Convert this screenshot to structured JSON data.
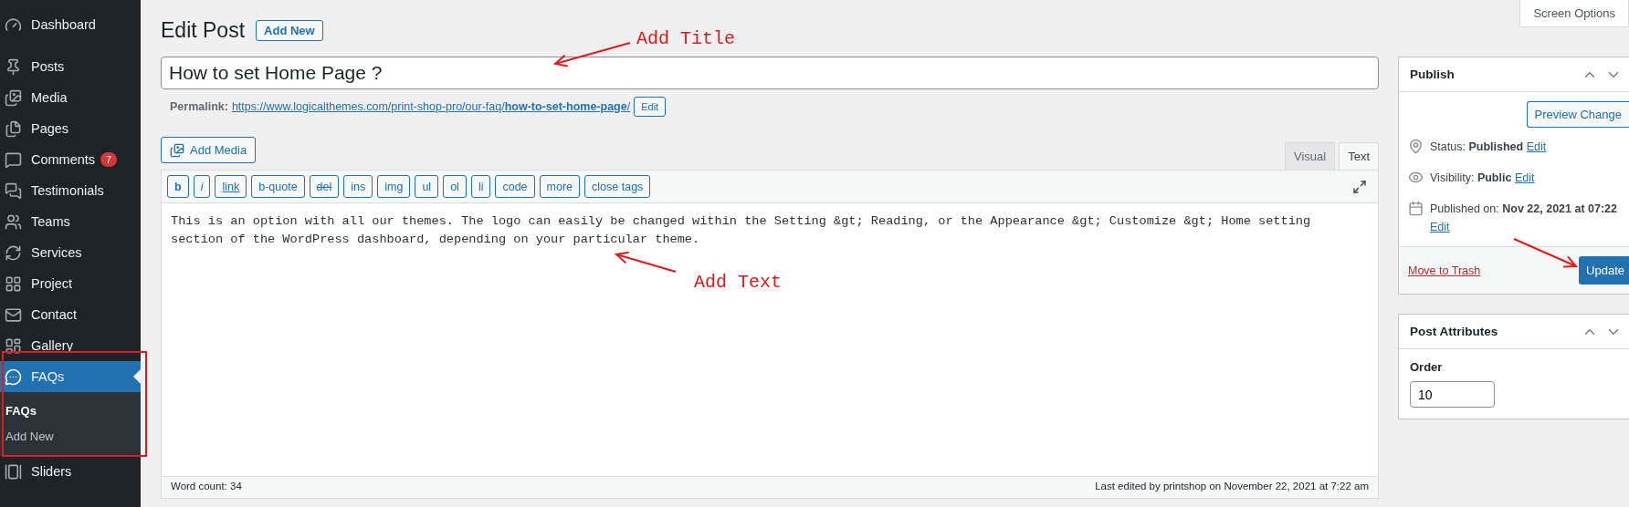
{
  "sidebar": {
    "items": [
      {
        "label": "Dashboard",
        "selected": false
      },
      {
        "label": "Posts",
        "selected": false
      },
      {
        "label": "Media",
        "selected": false
      },
      {
        "label": "Pages",
        "selected": false
      },
      {
        "label": "Comments",
        "selected": false,
        "badge": "7"
      },
      {
        "label": "Testimonials",
        "selected": false
      },
      {
        "label": "Teams",
        "selected": false
      },
      {
        "label": "Services",
        "selected": false
      },
      {
        "label": "Project",
        "selected": false
      },
      {
        "label": "Contact",
        "selected": false
      },
      {
        "label": "Gallery",
        "selected": false
      },
      {
        "label": "FAQs",
        "selected": true,
        "children": [
          {
            "label": "FAQs",
            "selected": true
          },
          {
            "label": "Add New",
            "selected": false
          }
        ]
      },
      {
        "label": "Sliders",
        "selected": false
      }
    ]
  },
  "header": {
    "title": "Edit Post",
    "add_new": "Add New"
  },
  "screen_options": "Screen Options",
  "title_field": {
    "value": "How to set Home Page ?"
  },
  "permalink": {
    "label": "Permalink:",
    "url": "https://www.logicalthemes.com/print-shop-pro/our-faq/**how-to-set-home-page**/",
    "edit": "Edit"
  },
  "add_media": "Add Media",
  "editor_tabs": [
    {
      "label": "Visual",
      "selected": false
    },
    {
      "label": "Text",
      "selected": true
    }
  ],
  "quicktags": [
    {
      "label": "b",
      "kind": "bold"
    },
    {
      "label": "i",
      "kind": "italic"
    },
    {
      "label": "link",
      "kind": "underline"
    },
    {
      "label": "b-quote",
      "kind": "plain"
    },
    {
      "label": "del",
      "kind": "strike"
    },
    {
      "label": "ins",
      "kind": "plain"
    },
    {
      "label": "img",
      "kind": "plain"
    },
    {
      "label": "ul",
      "kind": "plain"
    },
    {
      "label": "ol",
      "kind": "plain"
    },
    {
      "label": "li",
      "kind": "plain"
    },
    {
      "label": "code",
      "kind": "plain"
    },
    {
      "label": "more",
      "kind": "plain"
    },
    {
      "label": "close tags",
      "kind": "plain"
    }
  ],
  "content": "This is an option with all our themes. The logo can easily be changed within the Setting &gt; Reading, or the Appearance &gt; Customize &gt; Home setting section of the WordPress dashboard, depending on your particular theme.",
  "word_count": "Word count: 34",
  "last_edited": "Last edited by printshop on November 22, 2021 at 7:22 am",
  "publish": {
    "title": "Publish",
    "preview": "Preview Change",
    "rows": [
      {
        "label": "Status:",
        "value": "Published",
        "edit": "Edit"
      },
      {
        "label": "Visibility:",
        "value": "Public",
        "edit": "Edit"
      },
      {
        "label": "Published on:",
        "value": "Nov 22, 2021 at 07:22",
        "edit": "Edit"
      }
    ],
    "trash": "Move to Trash",
    "update": "Update"
  },
  "attributes": {
    "title": "Post Attributes",
    "order_label": "Order",
    "order_value": "10"
  },
  "annotations": [
    {
      "text": "Add Title"
    },
    {
      "text": "Add Text"
    }
  ]
}
